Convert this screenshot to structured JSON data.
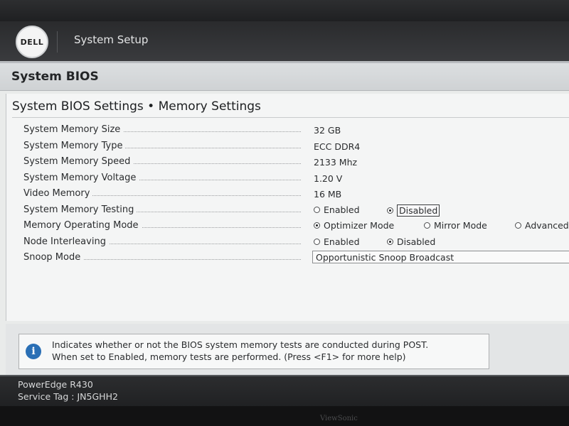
{
  "header": {
    "logo_text": "DELL",
    "title": "System Setup"
  },
  "section": {
    "title": "System BIOS"
  },
  "page": {
    "heading": "System BIOS Settings • Memory Settings"
  },
  "settings": {
    "memory_size": {
      "label": "System Memory Size",
      "value": "32 GB"
    },
    "memory_type": {
      "label": "System Memory Type",
      "value": "ECC DDR4"
    },
    "memory_speed": {
      "label": "System Memory Speed",
      "value": "2133 Mhz"
    },
    "memory_voltage": {
      "label": "System Memory Voltage",
      "value": "1.20 V"
    },
    "video_memory": {
      "label": "Video Memory",
      "value": "16 MB"
    },
    "memory_testing": {
      "label": "System Memory Testing",
      "options": [
        "Enabled",
        "Disabled"
      ],
      "selected": "Disabled"
    },
    "operating_mode": {
      "label": "Memory Operating Mode",
      "options": [
        "Optimizer Mode",
        "Mirror Mode",
        "Advanced"
      ],
      "selected": "Optimizer Mode"
    },
    "node_interleaving": {
      "label": "Node Interleaving",
      "options": [
        "Enabled",
        "Disabled"
      ],
      "selected": "Disabled"
    },
    "snoop_mode": {
      "label": "Snoop Mode",
      "value": "Opportunistic Snoop Broadcast"
    }
  },
  "help": {
    "icon": "info-icon",
    "line1": "Indicates whether or not the BIOS system memory tests are conducted during POST.",
    "line2": "When set to Enabled, memory tests are performed. (Press <F1> for more help)"
  },
  "footer": {
    "model": "PowerEdge R430",
    "service_tag": "Service Tag : JN5GHH2"
  },
  "monitor": {
    "brand": "ViewSonic"
  },
  "colors": {
    "info_blue": "#2a6fb5",
    "header_dark": "#2a2b2d"
  }
}
